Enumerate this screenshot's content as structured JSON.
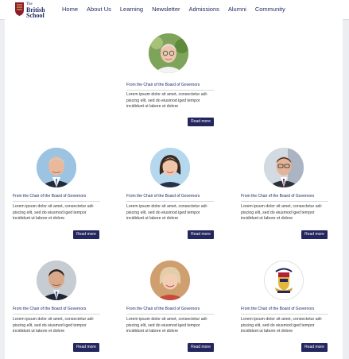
{
  "brand": {
    "line1": "The",
    "line2": "British School",
    "line3": "Rio de Janeiro"
  },
  "nav": [
    {
      "label": "Home"
    },
    {
      "label": "About Us"
    },
    {
      "label": "Learning"
    },
    {
      "label": "Newsletter"
    },
    {
      "label": "Admissions"
    },
    {
      "label": "Alumni"
    },
    {
      "label": "Community"
    }
  ],
  "cards": [
    {
      "title": "From the Chair of the Board of Governors",
      "body": "Lorem ipsum dolor sit amet, consectetur adi-piscing elit, sed do eiusmod iged tempor incididunt ut labore et dolore",
      "button": "Read more",
      "image": "portrait-older-man-glasses"
    },
    {
      "title": "From the Chair of the Board of Governors",
      "body": "Lorem ipsum dolor sit amet, consectetur adi-piscing elit, sed do eiusmod iged tempor incididunt ut labore et dolore",
      "button": "Read more",
      "image": "portrait-man-suit"
    },
    {
      "title": "From the Chair of the Board of Governors",
      "body": "Lorem ipsum dolor sit amet, consectetur adi-piscing elit, sed do eiusmod iged tempor incididunt ut labore et dolore",
      "button": "Read more",
      "image": "portrait-woman-dark-hair"
    },
    {
      "title": "From the Chair of the Board of Governors",
      "body": "Lorem ipsum dolor sit amet, consectetur adi-piscing elit, sed do eiusmod iged tempor incididunt ut labore et dolore",
      "button": "Read more",
      "image": "portrait-man-glasses"
    },
    {
      "title": "From the Chair of the Board of Governors",
      "body": "Lorem ipsum dolor sit amet, consectetur adi-piscing elit, sed do eiusmod iged tempor incididunt ut labore et dolore",
      "button": "Read more",
      "image": "portrait-man-dark-hair"
    },
    {
      "title": "From the Chair of the Board of Governors",
      "body": "Lorem ipsum dolor sit amet, consectetur adi-piscing elit, sed do eiusmod iged tempor incididunt ut labore et dolore",
      "button": "Read more",
      "image": "portrait-older-woman"
    },
    {
      "title": "From the Chair of the Board of Governors",
      "body": "Lorem ipsum dolor sit amet, consectetur adi-piscing elit, sed do eiusmod iged tempor incididunt ut labore et dolore",
      "button": "Read more",
      "image": "school-crest"
    }
  ],
  "colors": {
    "brand_navy": "#1f2a66",
    "button": "#24265f",
    "background": "#eceef2",
    "crest_red": "#8c1c2a"
  }
}
